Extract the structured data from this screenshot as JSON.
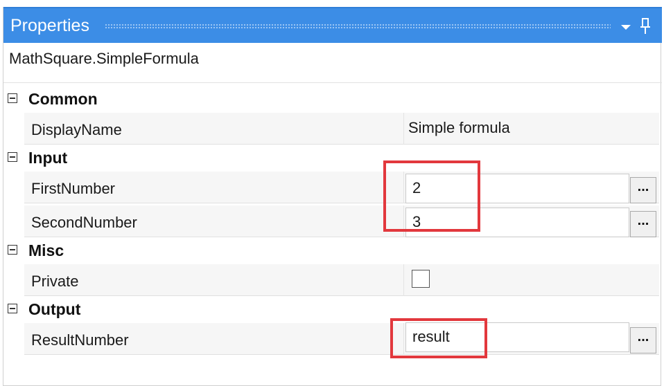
{
  "panel": {
    "title": "Properties",
    "subject": "MathSquare.SimpleFormula"
  },
  "categories": {
    "common": "Common",
    "input": "Input",
    "misc": "Misc",
    "output": "Output"
  },
  "properties": {
    "display_name": {
      "name": "DisplayName",
      "value": "Simple formula"
    },
    "first_number": {
      "name": "FirstNumber",
      "value": "2"
    },
    "second_number": {
      "name": "SecondNumber",
      "value": "3"
    },
    "private": {
      "name": "Private",
      "checked": false
    },
    "result_number": {
      "name": "ResultNumber",
      "value": "result"
    }
  },
  "ellipsis_label": "...",
  "colors": {
    "titlebar": "#3c8de6",
    "highlight": "#e2383d"
  },
  "icons": [
    "dropdown-icon",
    "pin-icon",
    "collapse-icon"
  ]
}
